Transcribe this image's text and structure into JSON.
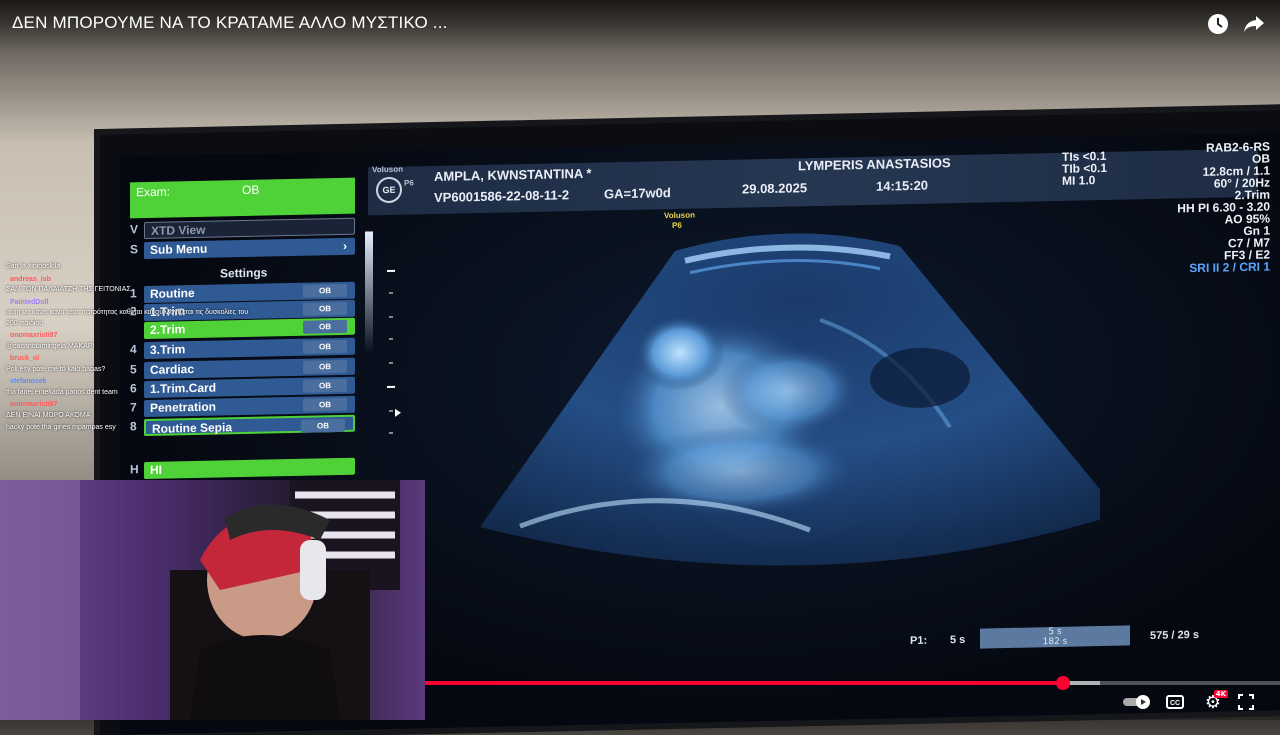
{
  "video": {
    "title": "ΔΕΝ ΜΠΟΡΟΥΜΕ ΝΑ ΤΟ ΚΡΑΤΑΜΕ ΑΛΛΟ ΜΥΣΤΙΚΟ ...",
    "watch_later_icon": "clock-icon",
    "share_icon": "share-icon",
    "progress_fraction": 0.746,
    "buffer_fraction": 0.79
  },
  "ultrasound": {
    "brand": "Voluson",
    "model": "P6",
    "patient": "AMPLA, KWNSTANTINA *",
    "study_id": "VP6001586-22-08-11-2",
    "ga": "GA=17w0d",
    "doctor": "LYMPERIS ANASTASIOS",
    "date": "29.08.2025",
    "time": "14:15:20",
    "tis": "TIs <0.1",
    "tib": "TIb <0.1",
    "mi": "MI  1.0",
    "right_info": [
      "RAB2-6-RS",
      "OB",
      "12.8cm / 1.1",
      "60° / 20Hz",
      "2.Trim",
      "HH PI 6.30 - 3.20",
      "AO 95%",
      "Gn  1",
      "C7 / M7",
      "FF3 / E2"
    ],
    "sri_line": "SRI II 2 / CRI 1",
    "overlay_brand": "Voluson",
    "overlay_model": "P6",
    "exam_label": "Exam:",
    "exam_value": "OB",
    "xtd_view": "XTD View",
    "sub_menu": "Sub Menu",
    "settings": "Settings",
    "presets": [
      {
        "num": "1",
        "label": "Routine",
        "ob": "OB"
      },
      {
        "num": "2",
        "label": "1.Trim",
        "ob": "OB"
      },
      {
        "num": "",
        "label": "2.Trim",
        "ob": "OB"
      },
      {
        "num": "4",
        "label": "3.Trim",
        "ob": "OB"
      },
      {
        "num": "5",
        "label": "Cardiac",
        "ob": "OB"
      },
      {
        "num": "6",
        "label": "1.Trim.Card",
        "ob": "OB"
      },
      {
        "num": "7",
        "label": "Penetration",
        "ob": "OB"
      },
      {
        "num": "8",
        "label": "Routine Sepia",
        "ob": "OB"
      }
    ],
    "hi_label": "HI",
    "p1": "P1:",
    "p1_val": "5 s",
    "bar_top": "5 s",
    "bar_bottom": "182 s",
    "frames": "575 / 29 s"
  },
  "chat": [
    {
      "user": "",
      "msg": "San la xinigoskila",
      "color": "#ffffff"
    },
    {
      "user": "andreas_isb",
      "msg": "ΣΑΝ ΤΟΝ ΠΑΛΑΙΑΤΖΗ ΤΗΣ ΓΕΙΤΟΝΙΑΣ",
      "color": "#ff5a5a"
    },
    {
      "user": "PaintedDoll",
      "msg": "αυτη να κανει κανα τεστ πατρότητας καθεται και συλλογίζεται τις δυσκολίες του 200 παιδιου",
      "color": "#a07cff"
    },
    {
      "user": "onomaxristi97",
      "msg": "@cacanotamingela ΜΑΚΑΡΙ",
      "color": "#ff5a5a"
    },
    {
      "user": "bruck_ol",
      "msg": "Poli esy pote me to kalo babas?",
      "color": "#ff5a5a"
    },
    {
      "user": "stefanosek",
      "msg": "tha fanei entekada panos dent team",
      "color": "#5a8cff"
    },
    {
      "user": "onomaxristi97",
      "msg": "ΔΕΝ ΕΙΝΑΙ ΜΩΡΟ ΑΚΟΜΑ",
      "color": "#ff5a5a"
    },
    {
      "user": "",
      "msg": "hacky pote tha gines mpampas esy",
      "color": "#ffffff"
    }
  ],
  "player": {
    "autoplay_icon": "autoplay-toggle-icon",
    "cc_icon": "captions-icon",
    "settings_icon": "settings-gear-icon",
    "quality_badge": "4K",
    "fullscreen_icon": "fullscreen-icon"
  }
}
